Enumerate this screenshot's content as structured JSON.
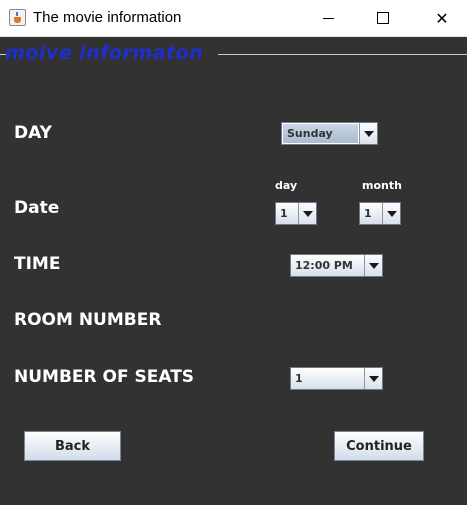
{
  "window": {
    "title": "The movie information",
    "icon": "java-cup-icon"
  },
  "panel": {
    "legend": "moive informaton"
  },
  "form": {
    "day_label": "DAY",
    "day_value": "Sunday",
    "date_label": "Date",
    "date_day_label": "day",
    "date_day_value": "1",
    "date_month_label": "month",
    "date_month_value": "1",
    "time_label": "TIME",
    "time_value": "12:00 PM",
    "room_label": "ROOM NUMBER",
    "seats_label": "NUMBER OF SEATS",
    "seats_value": "1"
  },
  "buttons": {
    "back": "Back",
    "continue": "Continue"
  },
  "colors": {
    "background": "#323232",
    "legend": "#1e2fd0",
    "label": "#ffffff"
  }
}
